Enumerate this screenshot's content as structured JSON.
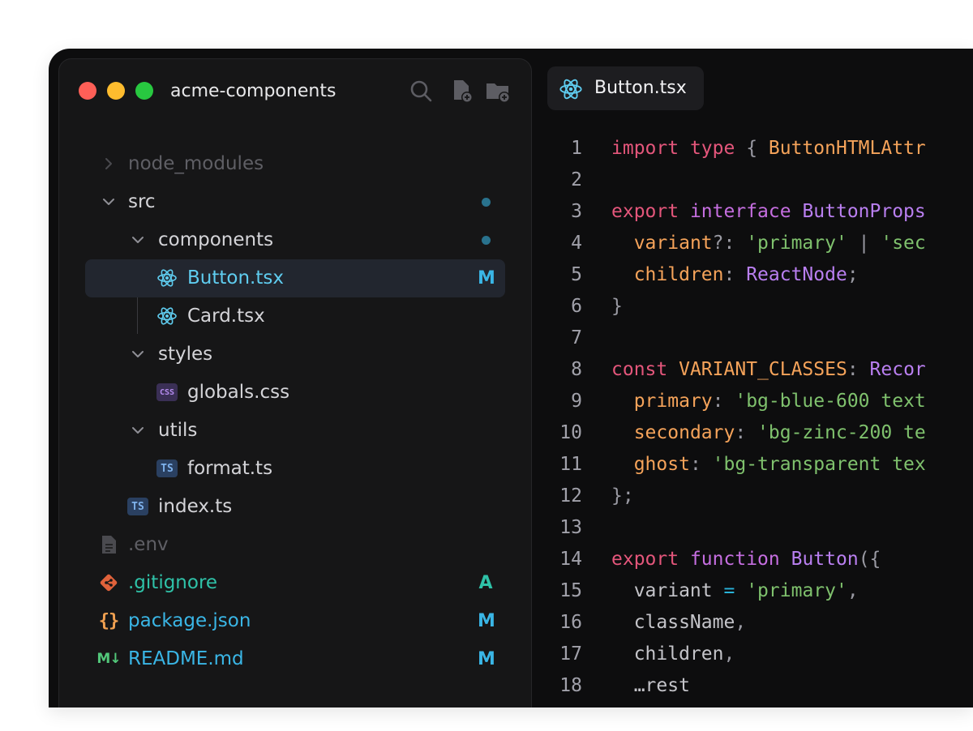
{
  "sidebar": {
    "project_name": "acme-components",
    "tree": [
      {
        "label": "node_modules",
        "kind": "folder",
        "expanded": false,
        "badge": "",
        "dot": false,
        "dim": true
      },
      {
        "label": "src",
        "kind": "folder",
        "expanded": true,
        "badge": "",
        "dot": true
      },
      {
        "label": "components",
        "kind": "folder",
        "expanded": true,
        "badge": "",
        "dot": true
      },
      {
        "label": "Button.tsx",
        "kind": "react",
        "badge": "M",
        "selected": true
      },
      {
        "label": "Card.tsx",
        "kind": "react",
        "badge": ""
      },
      {
        "label": "styles",
        "kind": "folder",
        "expanded": true,
        "badge": ""
      },
      {
        "label": "globals.css",
        "kind": "css",
        "icon_text": "CSS",
        "badge": ""
      },
      {
        "label": "utils",
        "kind": "folder",
        "expanded": true,
        "badge": ""
      },
      {
        "label": "format.ts",
        "kind": "ts",
        "icon_text": "TS",
        "badge": ""
      },
      {
        "label": "index.ts",
        "kind": "ts",
        "icon_text": "TS",
        "badge": ""
      },
      {
        "label": ".env",
        "kind": "file",
        "badge": "",
        "dim": true
      },
      {
        "label": ".gitignore",
        "kind": "git",
        "badge": "A"
      },
      {
        "label": "package.json",
        "kind": "json",
        "icon_text": "{}",
        "badge": "M"
      },
      {
        "label": "README.md",
        "kind": "markdown",
        "icon_text": "M↓",
        "badge": "M"
      }
    ]
  },
  "editor": {
    "active_tab": "Button.tsx",
    "lines": [
      {
        "n": "1",
        "tokens": [
          [
            "kw",
            "import"
          ],
          [
            "id",
            " "
          ],
          [
            "kw",
            "type"
          ],
          [
            "p",
            " { "
          ],
          [
            "ty",
            "ButtonHTMLAttr"
          ]
        ]
      },
      {
        "n": "2",
        "tokens": []
      },
      {
        "n": "3",
        "tokens": [
          [
            "kw",
            "export"
          ],
          [
            "id",
            " "
          ],
          [
            "kw2",
            "interface"
          ],
          [
            "id",
            " "
          ],
          [
            "fn",
            "ButtonProps"
          ]
        ]
      },
      {
        "n": "4",
        "tokens": [
          [
            "id",
            "  "
          ],
          [
            "prop",
            "variant"
          ],
          [
            "p",
            "?: "
          ],
          [
            "str",
            "'primary'"
          ],
          [
            "p",
            " | "
          ],
          [
            "str",
            "'sec"
          ]
        ]
      },
      {
        "n": "5",
        "tokens": [
          [
            "id",
            "  "
          ],
          [
            "prop",
            "children"
          ],
          [
            "p",
            ": "
          ],
          [
            "fn",
            "ReactNode"
          ],
          [
            "p",
            ";"
          ]
        ]
      },
      {
        "n": "6",
        "tokens": [
          [
            "p",
            "}"
          ]
        ]
      },
      {
        "n": "7",
        "tokens": []
      },
      {
        "n": "8",
        "tokens": [
          [
            "kw",
            "const"
          ],
          [
            "id",
            " "
          ],
          [
            "ty",
            "VARIANT_CLASSES"
          ],
          [
            "p",
            ": "
          ],
          [
            "fn",
            "Recor"
          ]
        ]
      },
      {
        "n": "9",
        "tokens": [
          [
            "id",
            "  "
          ],
          [
            "prop",
            "primary"
          ],
          [
            "p",
            ": "
          ],
          [
            "str",
            "'bg-blue-600 text"
          ]
        ]
      },
      {
        "n": "10",
        "tokens": [
          [
            "id",
            "  "
          ],
          [
            "prop",
            "secondary"
          ],
          [
            "p",
            ": "
          ],
          [
            "str",
            "'bg-zinc-200 te"
          ]
        ]
      },
      {
        "n": "11",
        "tokens": [
          [
            "id",
            "  "
          ],
          [
            "prop",
            "ghost"
          ],
          [
            "p",
            ": "
          ],
          [
            "str",
            "'bg-transparent tex"
          ]
        ]
      },
      {
        "n": "12",
        "tokens": [
          [
            "p",
            "};"
          ]
        ]
      },
      {
        "n": "13",
        "tokens": []
      },
      {
        "n": "14",
        "tokens": [
          [
            "kw",
            "export"
          ],
          [
            "id",
            " "
          ],
          [
            "kw2",
            "function"
          ],
          [
            "id",
            " "
          ],
          [
            "fn",
            "Button"
          ],
          [
            "p",
            "({"
          ]
        ]
      },
      {
        "n": "15",
        "tokens": [
          [
            "id",
            "  variant "
          ],
          [
            "op",
            "="
          ],
          [
            "id",
            " "
          ],
          [
            "str",
            "'primary'"
          ],
          [
            "p",
            ","
          ]
        ]
      },
      {
        "n": "16",
        "tokens": [
          [
            "id",
            "  className"
          ],
          [
            "p",
            ","
          ]
        ]
      },
      {
        "n": "17",
        "tokens": [
          [
            "id",
            "  children"
          ],
          [
            "p",
            ","
          ]
        ]
      },
      {
        "n": "18",
        "tokens": [
          [
            "id",
            "  …rest"
          ]
        ]
      }
    ]
  },
  "colors": {
    "window_bg": "#0d0d0e",
    "sidebar_bg": "#161617",
    "selected_row": "#22262f",
    "badge_modified": "#3ab6e6",
    "badge_added": "#2fc2a8",
    "react_icon": "#5fcdf0",
    "git_icon": "#e0623b",
    "json_icon": "#f0a050",
    "markdown_icon": "#52c77a",
    "ts_icon_bg": "#2a4061",
    "css_icon_bg": "#3a2f55"
  }
}
